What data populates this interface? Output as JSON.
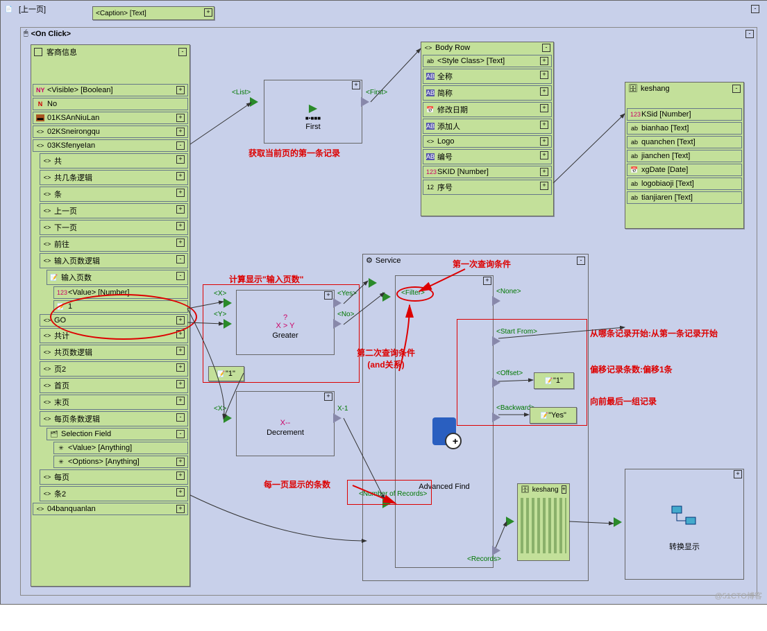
{
  "header": {
    "prev": "[上一页]",
    "caption": "<Caption> [Text]"
  },
  "onclick": "<On Click>",
  "sidebar": {
    "title": "客商信息",
    "visible": "<Visible> [Boolean]",
    "no": "No",
    "n1": "01KSAnNiuLan",
    "n2": "02KSneirongqu",
    "n3": "03KSfenyeIan",
    "items": [
      "共",
      "共几条逻辑",
      "条",
      "上一页",
      "下一页",
      "前往"
    ],
    "input_logic": "输入页数逻辑",
    "input_page": "输入页数",
    "value_num": "<Value> [Number]",
    "one": "1",
    "go": "GO",
    "total": "共计",
    "total_logic": "共页数逻辑",
    "page2": "页2",
    "first": "首页",
    "last": "末页",
    "perpage_logic": "每页条数逻辑",
    "selfield": "Selection Field",
    "val_any": "<Value> [Anything]",
    "opt_any": "<Options> [Anything]",
    "perpage": "每页",
    "tiao2": "条2",
    "n4": "04banquanlan"
  },
  "first": {
    "title": "First",
    "anno": "获取当前页的第一条记录",
    "list": "<List>",
    "first_port": "<First>"
  },
  "bodyrow": {
    "title": "Body Row",
    "items": [
      "<Style Class> [Text]",
      "全称",
      "简称",
      "修改日期",
      "添加人",
      "Logo",
      "编号",
      "SKID [Number]",
      "序号"
    ]
  },
  "keshang": {
    "title": "keshang",
    "items": [
      "KSid [Number]",
      "bianhao [Text]",
      "quanchen [Text]",
      "jianchen [Text]",
      "xgDate [Date]",
      "logobiaoji [Text]",
      "tianjiaren [Text]"
    ]
  },
  "greater": {
    "title": "Greater",
    "q": "?",
    "expr": "X > Y",
    "x": "<X>",
    "y": "<Y>",
    "yes": "<Yes>",
    "no": "<No>",
    "anno": "计算显示\"输入页数\""
  },
  "decrement": {
    "title": "Decrement",
    "expr": "X--",
    "x": "<X>",
    "out": "X-1",
    "one": "\"1\""
  },
  "service": {
    "title": "Service",
    "adv": "Advanced Find",
    "filter": "<Filter>",
    "none": "<None>",
    "start": "<Start From>",
    "offset": "<Offset>",
    "back": "<Backward>",
    "numrec": "<Number of Records>",
    "records": "<Records>",
    "one": "\"1\"",
    "yes": "\"Yes\"",
    "a1": "第一次查询条件",
    "a2": "第二次查询条件\n(and关系)",
    "a3": "每一页显示的条数",
    "a4": "从哪条记录开始:从第一条记录开始",
    "a5": "偏移记录条数:偏移1条",
    "a6": "向前最后一组记录"
  },
  "keshang2": "keshang",
  "convert": {
    "title": "转换显示"
  },
  "watermark": "@51CTO博客"
}
